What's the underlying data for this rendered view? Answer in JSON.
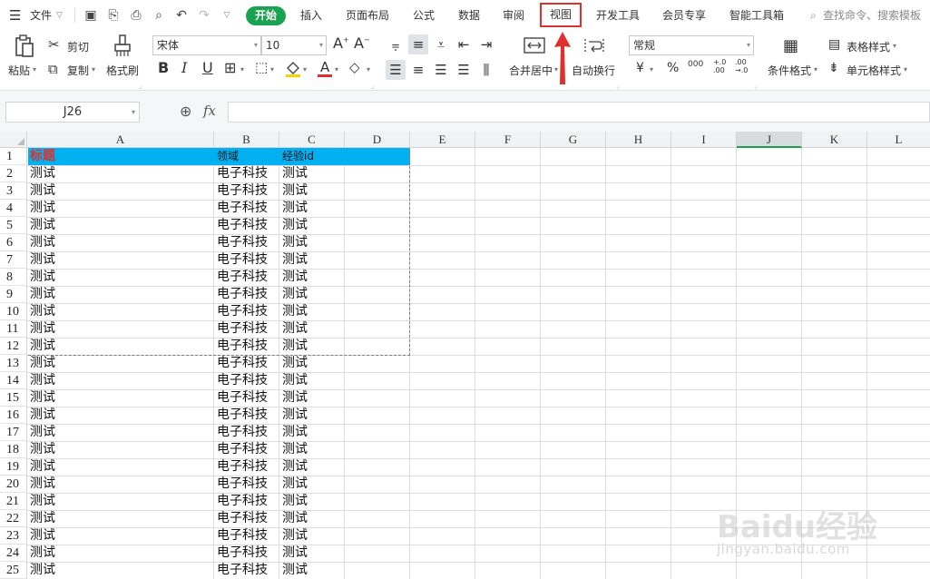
{
  "menu": {
    "file": "文件",
    "tabs": [
      "开始",
      "插入",
      "页面布局",
      "公式",
      "数据",
      "审阅",
      "视图",
      "开发工具",
      "会员专享",
      "智能工具箱"
    ],
    "active_tab": "开始",
    "highlighted_tab": "视图",
    "search_placeholder": "查找命令、搜索模板"
  },
  "ribbon": {
    "paste": "粘贴",
    "cut": "剪切",
    "copy": "复制",
    "format_painter": "格式刷",
    "font_name": "宋体",
    "font_size": "10",
    "bold": "B",
    "italic": "I",
    "underline": "U",
    "merge_center": "合并居中",
    "wrap_text": "自动换行",
    "number_format": "常规",
    "currency": "¥",
    "percent": "%",
    "thousands": "000",
    "inc_decimal": "+.0 .00",
    "dec_decimal": ".00 →.0",
    "conditional_format": "条件格式",
    "table_style": "表格样式",
    "cell_style": "单元格样式"
  },
  "formula_bar": {
    "name_box": "J26",
    "fx": "fx",
    "formula": ""
  },
  "sheet": {
    "columns": [
      "A",
      "B",
      "C",
      "D",
      "E",
      "F",
      "G",
      "H",
      "I",
      "J",
      "K",
      "L"
    ],
    "selected_column": "J",
    "row_numbers": [
      "1",
      "2",
      "3",
      "4",
      "5",
      "6",
      "7",
      "8",
      "9",
      "10",
      "11",
      "12",
      "13",
      "14",
      "15",
      "16",
      "17",
      "18",
      "19",
      "20",
      "21",
      "22",
      "23",
      "24",
      "25"
    ],
    "header": [
      "标题",
      "领域",
      "经验id"
    ],
    "rows": [
      [
        "测试",
        "电子科技",
        "测试"
      ],
      [
        "测试",
        "电子科技",
        "测试"
      ],
      [
        "测试",
        "电子科技",
        "测试"
      ],
      [
        "测试",
        "电子科技",
        "测试"
      ],
      [
        "测试",
        "电子科技",
        "测试"
      ],
      [
        "测试",
        "电子科技",
        "测试"
      ],
      [
        "测试",
        "电子科技",
        "测试"
      ],
      [
        "测试",
        "电子科技",
        "测试"
      ],
      [
        "测试",
        "电子科技",
        "测试"
      ],
      [
        "测试",
        "电子科技",
        "测试"
      ],
      [
        "测试",
        "电子科技",
        "测试"
      ],
      [
        "测试",
        "电子科技",
        "测试"
      ],
      [
        "测试",
        "电子科技",
        "测试"
      ],
      [
        "测试",
        "电子科技",
        "测试"
      ],
      [
        "测试",
        "电子科技",
        "测试"
      ],
      [
        "测试",
        "电子科技",
        "测试"
      ],
      [
        "测试",
        "电子科技",
        "测试"
      ],
      [
        "测试",
        "电子科技",
        "测试"
      ],
      [
        "测试",
        "电子科技",
        "测试"
      ],
      [
        "测试",
        "电子科技",
        "测试"
      ],
      [
        "测试",
        "电子科技",
        "测试"
      ],
      [
        "测试",
        "电子科技",
        "测试"
      ],
      [
        "测试",
        "电子科技",
        "测试"
      ],
      [
        "测试",
        "电子科技",
        "测试"
      ]
    ]
  },
  "colors": {
    "accent_green": "#1aa251",
    "header_fill": "#00b0f0",
    "title_red": "#e0302b",
    "highlight_red": "#e0302b"
  },
  "watermark": {
    "text": "Baidu经验",
    "url": "jingyan.baidu.com"
  }
}
